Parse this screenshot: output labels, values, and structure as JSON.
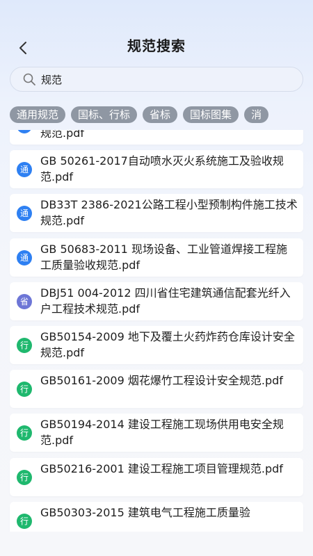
{
  "header": {
    "title": "规范搜索"
  },
  "search": {
    "value": "规范"
  },
  "tabs": [
    "通用规范",
    "国标、行标",
    "省标",
    "国标图集",
    "消"
  ],
  "documents": [
    {
      "badge": "通",
      "type": "tong",
      "title": "规范.pdf"
    },
    {
      "badge": "通",
      "type": "tong",
      "title": "GB 50261-2017自动喷水灭火系统施工及验收规范.pdf"
    },
    {
      "badge": "通",
      "type": "tong",
      "title": "DB33T 2386-2021公路工程小型预制构件施工技术规范.pdf"
    },
    {
      "badge": "通",
      "type": "tong",
      "title": "GB 50683-2011 现场设备、工业管道焊接工程施工质量验收规范.pdf"
    },
    {
      "badge": "省",
      "type": "sheng",
      "title": "DBJ51 004-2012 四川省住宅建筑通信配套光纤入户工程技术规范.pdf"
    },
    {
      "badge": "行",
      "type": "hang",
      "title": "GB50154-2009 地下及覆土火药炸药仓库设计安全规范.pdf"
    },
    {
      "badge": "行",
      "type": "hang",
      "title": "GB50161-2009 烟花爆竹工程设计安全规范.pdf"
    },
    {
      "badge": "行",
      "type": "hang",
      "title": "GB50194-2014 建设工程施工现场供用电安全规范.pdf"
    },
    {
      "badge": "行",
      "type": "hang",
      "title": "GB50216-2001 建设工程施工项目管理规范.pdf"
    },
    {
      "badge": "行",
      "type": "hang",
      "title": "GB50303-2015 建筑电气工程施工质量验"
    }
  ]
}
